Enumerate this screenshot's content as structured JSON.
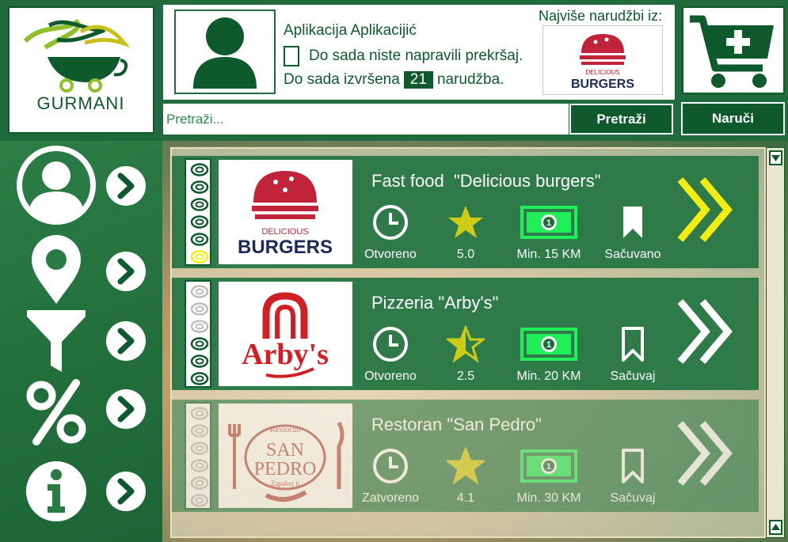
{
  "app": {
    "logo_text": "GURMANI"
  },
  "user": {
    "name": "Aplikacija Aplikacijić",
    "violation_text": "Do sada niste napravili prekršaj.",
    "orders_prefix": "Do sada izvršena",
    "orders_count": "21",
    "orders_suffix": "narudžba."
  },
  "top_restaurant": {
    "label": "Najviše narudžbi iz:"
  },
  "search": {
    "placeholder": "Pretraži...",
    "button_label": "Pretraži"
  },
  "order_button_label": "Naruči",
  "sidebar": {
    "items": [
      {
        "icon": "user-icon"
      },
      {
        "icon": "location-icon"
      },
      {
        "icon": "filter-icon"
      },
      {
        "icon": "percent-icon"
      },
      {
        "icon": "info-icon"
      }
    ]
  },
  "restaurants": [
    {
      "title": "Fast food  \"Delicious burgers\"",
      "status": "Otvoreno",
      "rating": "5.0",
      "rating_value": 5.0,
      "price": "Min. 15 KM",
      "saved": "Sačuvano",
      "level": 6,
      "arrow_color": "#f2ee14"
    },
    {
      "title": "Pizzeria \"Arby's\"",
      "status": "Otvoreno",
      "rating": "2.5",
      "rating_value": 2.5,
      "price": "Min. 20 KM",
      "saved": "Sačuvaj",
      "level": 3,
      "arrow_color": "#ffffff"
    },
    {
      "title": "Restoran \"San Pedro\"",
      "status": "Zatvoreno",
      "rating": "4.1",
      "rating_value": 4.1,
      "price": "Min. 30 KM",
      "saved": "Sačuvaj",
      "level": 0,
      "arrow_color": "#ffffff"
    }
  ],
  "logos": {
    "burgers_line1": "DELICIOUS",
    "burgers_line2": "BURGERS",
    "arbys": "Arby's",
    "sanpedro_top": "Restoran",
    "sanpedro_line1": "SAN",
    "sanpedro_line2": "PEDRO",
    "sanpedro_bottom": "Zapakuj ti"
  },
  "colors": {
    "primary": "#0e5a2c",
    "card": "#2e7a49",
    "star": "#cfcc17",
    "money": "#1ff05a",
    "accent_arrow": "#f2ee14"
  }
}
